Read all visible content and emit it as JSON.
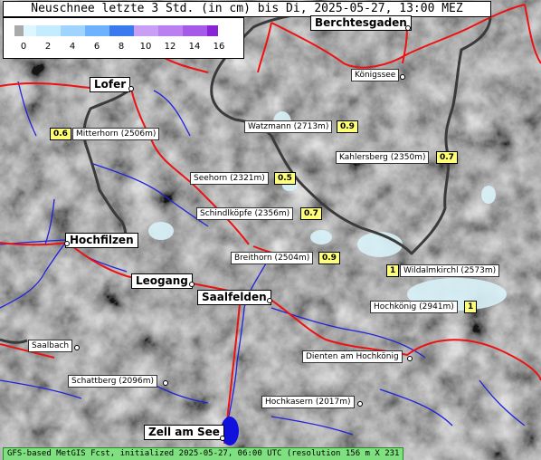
{
  "title": "Neuschnee letzte 3 Std. (in cm) bis Di, 2025-05-27, 13:00 MEZ",
  "legend": {
    "ticks": [
      "0",
      "2",
      "4",
      "6",
      "8",
      "10",
      "12",
      "14",
      "16"
    ],
    "colors": [
      "#aaaaaa",
      "#ddf6ff",
      "#c4ecff",
      "#9fd4ff",
      "#6eb2ff",
      "#3a7aee",
      "#c99ef5",
      "#ba7ff0",
      "#a55ae8",
      "#8a22d6"
    ]
  },
  "towns": [
    {
      "name": "Berchtesgaden"
    },
    {
      "name": "Lofer"
    },
    {
      "name": "Hochfilzen"
    },
    {
      "name": "Leogang"
    },
    {
      "name": "Saalfelden"
    },
    {
      "name": "Zell am See"
    }
  ],
  "places": [
    {
      "name": "Königssee"
    },
    {
      "name": "Saalbach"
    },
    {
      "name": "Dienten am Hochkönig"
    },
    {
      "name": "Schattberg (2096m)"
    },
    {
      "name": "Hochkasern (2017m)"
    }
  ],
  "peaks": [
    {
      "name": "Watzmann (2713m)",
      "value": "0.9"
    },
    {
      "name": "Mitterhorn (2506m)",
      "value": "0.6"
    },
    {
      "name": "Kahlersberg (2350m)",
      "value": "0.7"
    },
    {
      "name": "Seehorn (2321m)",
      "value": "0.5"
    },
    {
      "name": "Schindlköpfe (2356m)",
      "value": "0.7"
    },
    {
      "name": "Breithorn (2504m)",
      "value": "0.9"
    },
    {
      "name": "Wildalmkirchl (2573m)",
      "value": "1"
    },
    {
      "name": "Hochkönig (2941m)",
      "value": "1"
    }
  ],
  "footer": "GFS-based MetGIS Fcst, initialized 2025-05-27, 06:00 UTC  (resolution 156 m X 231 m)"
}
